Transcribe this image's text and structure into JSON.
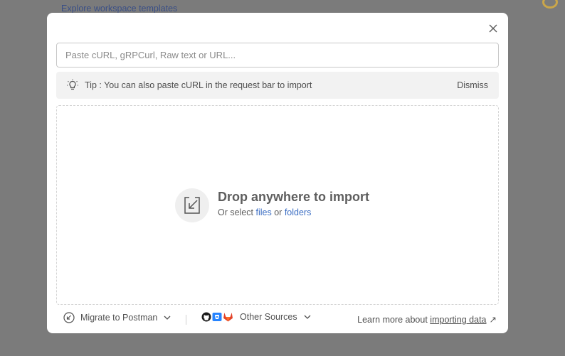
{
  "background": {
    "link_text": "Explore workspace templates"
  },
  "modal": {
    "input_placeholder": "Paste cURL, gRPCurl, Raw text or URL...",
    "tip_text": "Tip : You can also paste cURL in the request bar to import",
    "dismiss_label": "Dismiss",
    "drop_title": "Drop anywhere to import",
    "drop_sub_prefix": "Or select",
    "files_label": "files",
    "or_label": "or",
    "folders_label": "folders",
    "footer": {
      "migrate_label": "Migrate to Postman",
      "other_sources_label": "Other Sources",
      "learn_prefix": "Learn more about",
      "learn_link": "importing data",
      "learn_arrow": "↗"
    }
  },
  "colors": {
    "overlay": "#7b7b7b",
    "link_blue": "#3d6fc4",
    "gitlab_orange": "#e2432a",
    "bitbucket_blue": "#2684ff"
  },
  "icons": [
    "close-icon",
    "lightbulb-icon",
    "import-icon",
    "migrate-icon",
    "chevron-down-icon",
    "github-icon",
    "bitbucket-icon",
    "gitlab-icon",
    "external-arrow-icon"
  ]
}
